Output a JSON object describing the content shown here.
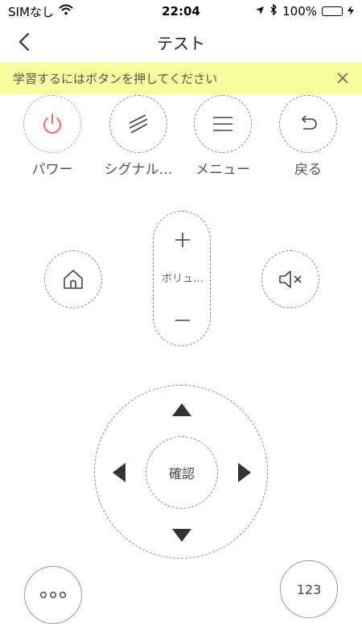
{
  "status_bar": {
    "carrier": "SIMなし",
    "time": "22:04",
    "battery_percent": "100%",
    "battery_level": 1.0
  },
  "nav": {
    "title": "テスト"
  },
  "banner": {
    "text": "学習するにはボタンを押してください"
  },
  "top_buttons": [
    {
      "label": "パワー",
      "icon": "power-icon"
    },
    {
      "label": "シグナル…",
      "icon": "signal-icon"
    },
    {
      "label": "メニュー",
      "icon": "menu-icon"
    },
    {
      "label": "戻る",
      "icon": "return-icon"
    }
  ],
  "volume": {
    "label": "ボリュ…",
    "up_icon": "plus-icon",
    "down_icon": "minus-icon"
  },
  "home": {
    "icon": "home-icon"
  },
  "mute": {
    "icon": "mute-icon"
  },
  "dpad": {
    "ok_label": "確認"
  },
  "bottom": {
    "more_icon": "more-icon",
    "numpad_label": "123"
  },
  "colors": {
    "banner_bg": "#fafa9e",
    "power_accent": "#ee6b6b",
    "battery_fill": "#3ec93e",
    "dashed_border": "#888888"
  }
}
